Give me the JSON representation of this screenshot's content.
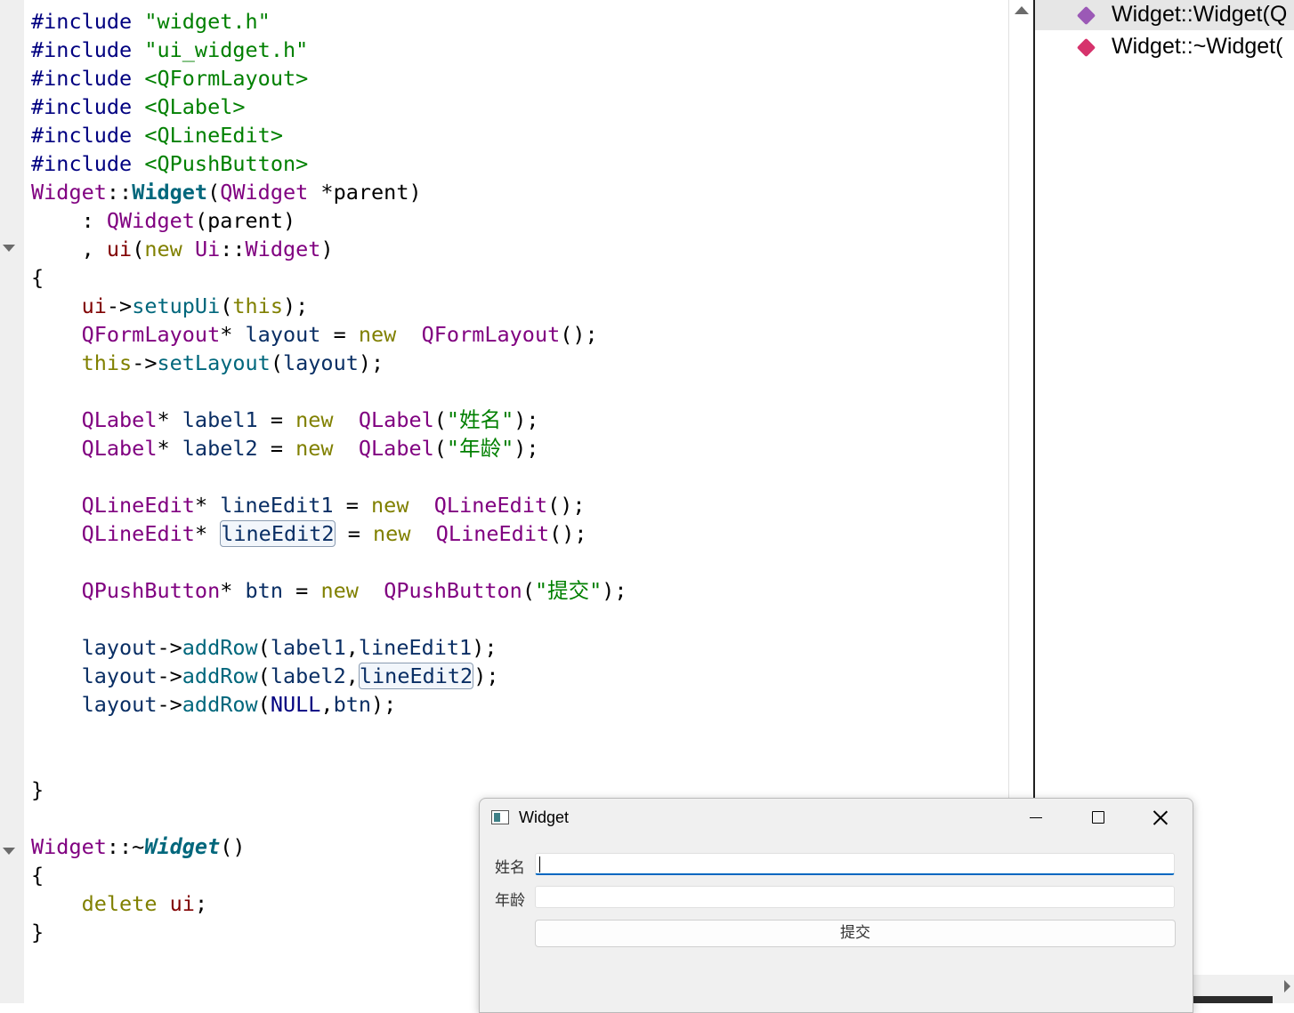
{
  "editor": {
    "lines": [
      [
        {
          "c": "pp",
          "t": "#include "
        },
        {
          "c": "str",
          "t": "\"widget.h\""
        }
      ],
      [
        {
          "c": "pp",
          "t": "#include "
        },
        {
          "c": "str",
          "t": "\"ui_widget.h\""
        }
      ],
      [
        {
          "c": "pp",
          "t": "#include "
        },
        {
          "c": "str",
          "t": "<QFormLayout>"
        }
      ],
      [
        {
          "c": "pp",
          "t": "#include "
        },
        {
          "c": "str",
          "t": "<QLabel>"
        }
      ],
      [
        {
          "c": "pp",
          "t": "#include "
        },
        {
          "c": "str",
          "t": "<QLineEdit>"
        }
      ],
      [
        {
          "c": "pp",
          "t": "#include "
        },
        {
          "c": "str",
          "t": "<QPushButton>"
        }
      ],
      [
        {
          "c": "ty",
          "t": "Widget"
        },
        {
          "c": "",
          "t": "::"
        },
        {
          "c": "fnb",
          "t": "Widget"
        },
        {
          "c": "",
          "t": "("
        },
        {
          "c": "ty",
          "t": "QWidget"
        },
        {
          "c": "",
          "t": " *parent)"
        }
      ],
      [
        {
          "c": "",
          "t": "    : "
        },
        {
          "c": "ty",
          "t": "QWidget"
        },
        {
          "c": "",
          "t": "(parent)"
        }
      ],
      [
        {
          "c": "",
          "t": "    , "
        },
        {
          "c": "mem",
          "t": "ui"
        },
        {
          "c": "",
          "t": "("
        },
        {
          "c": "kw",
          "t": "new"
        },
        {
          "c": "",
          "t": " "
        },
        {
          "c": "ty",
          "t": "Ui"
        },
        {
          "c": "",
          "t": "::"
        },
        {
          "c": "ty",
          "t": "Widget"
        },
        {
          "c": "",
          "t": ")"
        }
      ],
      [
        {
          "c": "",
          "t": "{"
        }
      ],
      [
        {
          "c": "",
          "t": "    "
        },
        {
          "c": "mem",
          "t": "ui"
        },
        {
          "c": "",
          "t": "->"
        },
        {
          "c": "fn",
          "t": "setupUi"
        },
        {
          "c": "",
          "t": "("
        },
        {
          "c": "kw",
          "t": "this"
        },
        {
          "c": "",
          "t": ");"
        }
      ],
      [
        {
          "c": "",
          "t": "    "
        },
        {
          "c": "ty",
          "t": "QFormLayout"
        },
        {
          "c": "",
          "t": "* "
        },
        {
          "c": "var",
          "t": "layout"
        },
        {
          "c": "",
          "t": " = "
        },
        {
          "c": "kw",
          "t": "new"
        },
        {
          "c": "",
          "t": "  "
        },
        {
          "c": "ty",
          "t": "QFormLayout"
        },
        {
          "c": "",
          "t": "();"
        }
      ],
      [
        {
          "c": "",
          "t": "    "
        },
        {
          "c": "kw",
          "t": "this"
        },
        {
          "c": "",
          "t": "->"
        },
        {
          "c": "fn",
          "t": "setLayout"
        },
        {
          "c": "",
          "t": "("
        },
        {
          "c": "var",
          "t": "layout"
        },
        {
          "c": "",
          "t": ");"
        }
      ],
      [],
      [
        {
          "c": "",
          "t": "    "
        },
        {
          "c": "ty",
          "t": "QLabel"
        },
        {
          "c": "",
          "t": "* "
        },
        {
          "c": "var",
          "t": "label1"
        },
        {
          "c": "",
          "t": " = "
        },
        {
          "c": "kw",
          "t": "new"
        },
        {
          "c": "",
          "t": "  "
        },
        {
          "c": "ty",
          "t": "QLabel"
        },
        {
          "c": "",
          "t": "("
        },
        {
          "c": "str",
          "t": "\"姓名\""
        },
        {
          "c": "",
          "t": ");"
        }
      ],
      [
        {
          "c": "",
          "t": "    "
        },
        {
          "c": "ty",
          "t": "QLabel"
        },
        {
          "c": "",
          "t": "* "
        },
        {
          "c": "var",
          "t": "label2"
        },
        {
          "c": "",
          "t": " = "
        },
        {
          "c": "kw",
          "t": "new"
        },
        {
          "c": "",
          "t": "  "
        },
        {
          "c": "ty",
          "t": "QLabel"
        },
        {
          "c": "",
          "t": "("
        },
        {
          "c": "str",
          "t": "\"年龄\""
        },
        {
          "c": "",
          "t": ");"
        }
      ],
      [],
      [
        {
          "c": "",
          "t": "    "
        },
        {
          "c": "ty",
          "t": "QLineEdit"
        },
        {
          "c": "",
          "t": "* "
        },
        {
          "c": "var",
          "t": "lineEdit1"
        },
        {
          "c": "",
          "t": " = "
        },
        {
          "c": "kw",
          "t": "new"
        },
        {
          "c": "",
          "t": "  "
        },
        {
          "c": "ty",
          "t": "QLineEdit"
        },
        {
          "c": "",
          "t": "();"
        }
      ],
      [
        {
          "c": "",
          "t": "    "
        },
        {
          "c": "ty",
          "t": "QLineEdit"
        },
        {
          "c": "",
          "t": "* "
        },
        {
          "c": "var hl",
          "t": "lineEdit2"
        },
        {
          "c": "",
          "t": " = "
        },
        {
          "c": "kw",
          "t": "new"
        },
        {
          "c": "",
          "t": "  "
        },
        {
          "c": "ty",
          "t": "QLineEdit"
        },
        {
          "c": "",
          "t": "();"
        }
      ],
      [],
      [
        {
          "c": "",
          "t": "    "
        },
        {
          "c": "ty",
          "t": "QPushButton"
        },
        {
          "c": "",
          "t": "* "
        },
        {
          "c": "var",
          "t": "btn"
        },
        {
          "c": "",
          "t": " = "
        },
        {
          "c": "kw",
          "t": "new"
        },
        {
          "c": "",
          "t": "  "
        },
        {
          "c": "ty",
          "t": "QPushButton"
        },
        {
          "c": "",
          "t": "("
        },
        {
          "c": "str",
          "t": "\"提交\""
        },
        {
          "c": "",
          "t": ");"
        }
      ],
      [],
      [
        {
          "c": "",
          "t": "    "
        },
        {
          "c": "var",
          "t": "layout"
        },
        {
          "c": "",
          "t": "->"
        },
        {
          "c": "fn",
          "t": "addRow"
        },
        {
          "c": "",
          "t": "("
        },
        {
          "c": "var",
          "t": "label1"
        },
        {
          "c": "",
          "t": ","
        },
        {
          "c": "var",
          "t": "lineEdit1"
        },
        {
          "c": "",
          "t": ");"
        }
      ],
      [
        {
          "c": "",
          "t": "    "
        },
        {
          "c": "var",
          "t": "layout"
        },
        {
          "c": "",
          "t": "->"
        },
        {
          "c": "fn",
          "t": "addRow"
        },
        {
          "c": "",
          "t": "("
        },
        {
          "c": "var",
          "t": "label2"
        },
        {
          "c": "",
          "t": ","
        },
        {
          "c": "var hl",
          "t": "lineEdit2"
        },
        {
          "c": "",
          "t": ");"
        }
      ],
      [
        {
          "c": "",
          "t": "    "
        },
        {
          "c": "var",
          "t": "layout"
        },
        {
          "c": "",
          "t": "->"
        },
        {
          "c": "fn",
          "t": "addRow"
        },
        {
          "c": "",
          "t": "("
        },
        {
          "c": "pp",
          "t": "NULL"
        },
        {
          "c": "",
          "t": ","
        },
        {
          "c": "var",
          "t": "btn"
        },
        {
          "c": "",
          "t": ");"
        }
      ],
      [],
      [],
      [
        {
          "c": "",
          "t": "}"
        }
      ],
      [],
      [
        {
          "c": "ty",
          "t": "Widget"
        },
        {
          "c": "",
          "t": "::~"
        },
        {
          "c": "fni",
          "t": "Widget"
        },
        {
          "c": "",
          "t": "()"
        }
      ],
      [
        {
          "c": "",
          "t": "{"
        }
      ],
      [
        {
          "c": "",
          "t": "    "
        },
        {
          "c": "kw",
          "t": "delete"
        },
        {
          "c": "",
          "t": " "
        },
        {
          "c": "mem",
          "t": "ui"
        },
        {
          "c": "",
          "t": ";"
        }
      ],
      [
        {
          "c": "",
          "t": "}"
        }
      ]
    ]
  },
  "outline": {
    "items": [
      {
        "label": "Widget::Widget(Q",
        "color": "#9b59b6"
      },
      {
        "label": "Widget::~Widget(",
        "color": "#d6336c"
      }
    ]
  },
  "window": {
    "title": "Widget",
    "name_label": "姓名",
    "age_label": "年龄",
    "name_value": "",
    "age_value": "",
    "submit_label": "提交"
  }
}
